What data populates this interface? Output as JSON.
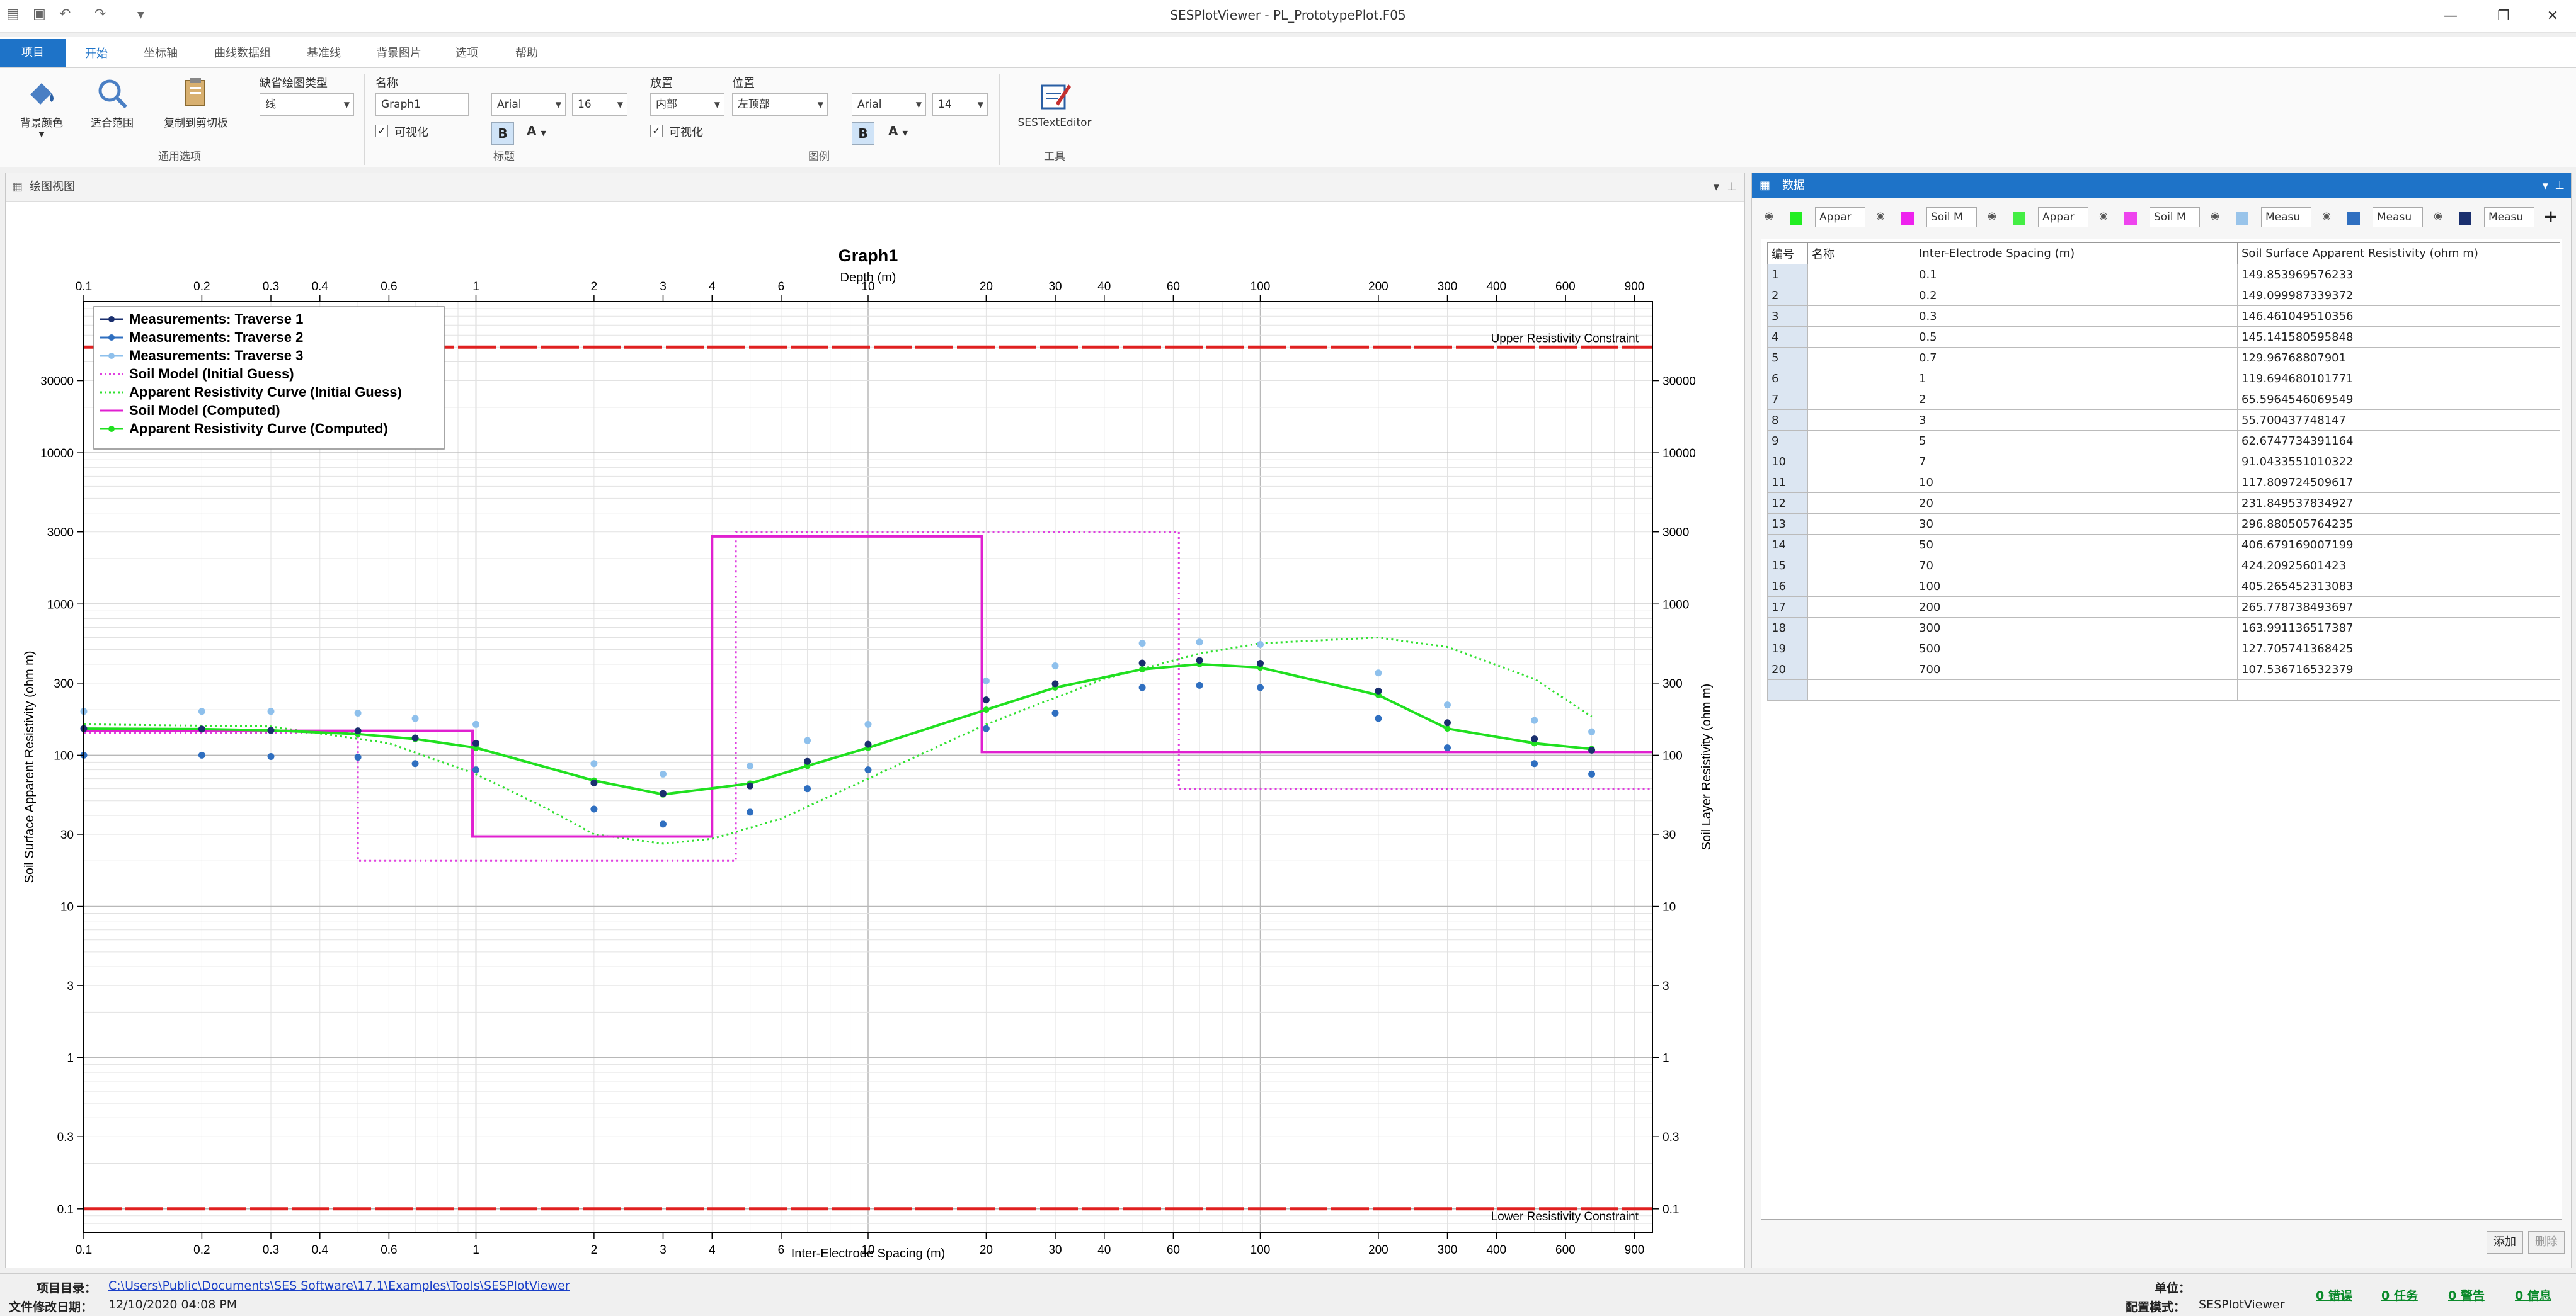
{
  "window": {
    "title": "SESPlotViewer - PL_PrototypePlot.F05",
    "minimize": "—",
    "restore": "❐",
    "close": "✕"
  },
  "menu": {
    "file": "项目",
    "tabs": [
      "开始",
      "坐标轴",
      "曲线数据组",
      "基准线",
      "背景图片",
      "选项",
      "帮助"
    ]
  },
  "ribbon": {
    "background_color": "背景颜色",
    "fit_range": "适合范围",
    "copy_clipboard": "复制到剪切板",
    "group_general": "通用选项",
    "default_plot_type_label": "缺省绘图类型",
    "default_plot_type": "线",
    "title_name_label": "名称",
    "title_name": "Graph1",
    "title_visible": "可视化",
    "title_font": "Arial",
    "title_size": "16",
    "group_title": "标题",
    "legend_place_label": "放置",
    "legend_place": "内部",
    "legend_pos_label": "位置",
    "legend_pos": "左顶部",
    "legend_visible": "可视化",
    "legend_font": "Arial",
    "legend_size": "14",
    "group_legend": "图例",
    "text_editor": "SESTextEditor",
    "group_tools": "工具",
    "bold_glyph": "B",
    "color_glyph": "A"
  },
  "plot_panel": {
    "title": "绘图视图"
  },
  "chart_data": {
    "type": "line",
    "title": "Graph1",
    "top_axis_label": "Depth (m)",
    "xlabel": "Inter-Electrode Spacing (m)",
    "ylabel_left": "Soil Surface Apparent Resistivity (ohm m)",
    "ylabel_right": "Soil Layer Resistivity (ohm m)",
    "x_scale": "log",
    "y_scale": "log",
    "xlim": [
      0.1,
      1000
    ],
    "ylim": [
      0.07,
      100000
    ],
    "x_ticks": [
      0.1,
      0.2,
      0.3,
      0.4,
      0.6,
      1,
      2,
      3,
      4,
      6,
      10,
      20,
      30,
      40,
      60,
      100,
      200,
      300,
      400,
      600,
      900
    ],
    "x_tick_labels": [
      "0.1",
      "0.2",
      "0.3",
      "0.4",
      "0.6",
      "1",
      "2",
      "3",
      "4",
      "6",
      "10",
      "20",
      "30",
      "40",
      "60",
      "100",
      "200",
      "300",
      "400",
      "600",
      "900"
    ],
    "y_ticks": [
      0.1,
      0.3,
      1,
      3,
      10,
      30,
      100,
      300,
      1000,
      3000,
      10000,
      30000
    ],
    "y_tick_labels": [
      "0.1",
      "0.3",
      "1",
      "3",
      "10",
      "30",
      "100",
      "300",
      "1000",
      "3000",
      "10000",
      "30000"
    ],
    "grid": true,
    "legend_position": "top-left",
    "reference_lines": [
      {
        "label": "Upper Resistivity Constraint",
        "y": 50000,
        "color": "#e02020"
      },
      {
        "label": "Lower Resistivity Constraint",
        "y": 0.1,
        "color": "#e02020"
      }
    ],
    "series": [
      {
        "name": "Measurements: Traverse 1",
        "kind": "points",
        "color": "#1a2f6e",
        "x": [
          0.1,
          0.2,
          0.3,
          0.5,
          0.7,
          1,
          2,
          3,
          5,
          7,
          10,
          20,
          30,
          50,
          70,
          100,
          200,
          300,
          500,
          700
        ],
        "y": [
          150,
          149,
          146,
          145,
          130,
          120,
          65.6,
          55.7,
          62.7,
          91,
          118,
          232,
          297,
          407,
          424,
          405,
          266,
          164,
          128,
          108
        ]
      },
      {
        "name": "Measurements: Traverse 2",
        "kind": "points",
        "color": "#2f6fc0",
        "x": [
          0.1,
          0.2,
          0.3,
          0.5,
          0.7,
          1,
          2,
          3,
          5,
          7,
          10,
          20,
          30,
          50,
          70,
          100,
          200,
          300,
          500,
          700
        ],
        "y": [
          100,
          100,
          98,
          97,
          88,
          80,
          44,
          35,
          42,
          60,
          80,
          150,
          190,
          280,
          290,
          280,
          175,
          112,
          88,
          75
        ]
      },
      {
        "name": "Measurements: Traverse 3",
        "kind": "points",
        "color": "#8ec0ec",
        "x": [
          0.1,
          0.2,
          0.3,
          0.5,
          0.7,
          1,
          2,
          3,
          5,
          7,
          10,
          20,
          30,
          50,
          70,
          100,
          200,
          300,
          500,
          700
        ],
        "y": [
          195,
          195,
          195,
          190,
          175,
          160,
          88,
          75,
          85,
          125,
          160,
          310,
          390,
          550,
          560,
          540,
          350,
          215,
          170,
          143
        ]
      },
      {
        "name": "Soil Model (Initial Guess)",
        "kind": "step-dotted",
        "color": "#e040e0",
        "x": [
          0.1,
          0.5,
          0.5,
          4.6,
          4.6,
          62,
          62,
          1000
        ],
        "y": [
          140,
          140,
          20,
          20,
          3000,
          3000,
          60,
          60
        ]
      },
      {
        "name": "Apparent Resistivity Curve (Initial Guess)",
        "kind": "line-dotted",
        "color": "#30e030",
        "x": [
          0.1,
          0.3,
          0.6,
          1,
          1.5,
          2,
          3,
          4,
          6,
          10,
          20,
          40,
          70,
          100,
          200,
          300,
          500,
          700
        ],
        "y": [
          160,
          155,
          120,
          75,
          45,
          30,
          26,
          28,
          38,
          70,
          160,
          320,
          470,
          550,
          600,
          520,
          320,
          180
        ]
      },
      {
        "name": "Soil Model (Computed)",
        "kind": "step",
        "color": "#e020d0",
        "x": [
          0.1,
          0.98,
          0.98,
          4.0,
          4.0,
          19.5,
          19.5,
          1000
        ],
        "y": [
          145,
          145,
          29,
          29,
          2800,
          2800,
          105,
          105
        ]
      },
      {
        "name": "Apparent Resistivity Curve (Computed)",
        "kind": "line-markers",
        "color": "#20e020",
        "x": [
          0.1,
          0.2,
          0.3,
          0.5,
          0.7,
          1,
          2,
          3,
          5,
          7,
          10,
          20,
          30,
          50,
          70,
          100,
          200,
          300,
          500,
          700
        ],
        "y": [
          150,
          149,
          146,
          138,
          128,
          112,
          68,
          55,
          65,
          85,
          112,
          200,
          280,
          370,
          400,
          380,
          250,
          150,
          120,
          110
        ]
      }
    ]
  },
  "data_panel": {
    "title": "数据",
    "series_tabs": [
      {
        "name": "Appar",
        "color": "#22ee22"
      },
      {
        "name": "Soil M",
        "color": "#ee22ee"
      },
      {
        "name": "Appar",
        "color": "#44ee44"
      },
      {
        "name": "Soil M",
        "color": "#ee44ee"
      },
      {
        "name": "Measu",
        "color": "#99c4ea"
      },
      {
        "name": "Measu",
        "color": "#2f6fc0"
      },
      {
        "name": "Measu",
        "color": "#1a2f6e"
      }
    ],
    "add_tab": "+",
    "headers": [
      "编号",
      "名称",
      "Inter-Electrode Spacing (m)",
      "Soil Surface Apparent Resistivity (ohm m)"
    ],
    "rows": [
      [
        "1",
        "",
        "0.1",
        "149.853969576233"
      ],
      [
        "2",
        "",
        "0.2",
        "149.099987339372"
      ],
      [
        "3",
        "",
        "0.3",
        "146.461049510356"
      ],
      [
        "4",
        "",
        "0.5",
        "145.141580595848"
      ],
      [
        "5",
        "",
        "0.7",
        "129.96768807901"
      ],
      [
        "6",
        "",
        "1",
        "119.694680101771"
      ],
      [
        "7",
        "",
        "2",
        "65.5964546069549"
      ],
      [
        "8",
        "",
        "3",
        "55.700437748147"
      ],
      [
        "9",
        "",
        "5",
        "62.6747734391164"
      ],
      [
        "10",
        "",
        "7",
        "91.0433551010322"
      ],
      [
        "11",
        "",
        "10",
        "117.809724509617"
      ],
      [
        "12",
        "",
        "20",
        "231.849537834927"
      ],
      [
        "13",
        "",
        "30",
        "296.880505764235"
      ],
      [
        "14",
        "",
        "50",
        "406.679169007199"
      ],
      [
        "15",
        "",
        "70",
        "424.20925601423"
      ],
      [
        "16",
        "",
        "100",
        "405.265452313083"
      ],
      [
        "17",
        "",
        "200",
        "265.778738493697"
      ],
      [
        "18",
        "",
        "300",
        "163.991136517387"
      ],
      [
        "19",
        "",
        "500",
        "127.705741368425"
      ],
      [
        "20",
        "",
        "700",
        "107.536716532379"
      ]
    ],
    "add_button": "添加",
    "delete_button": "删除"
  },
  "status": {
    "project_dir_label": "项目目录：",
    "project_dir": "C:\\Users\\Public\\Documents\\SES Software\\17.1\\Examples\\Tools\\SESPlotViewer",
    "modified_label": "文件修改日期：",
    "modified": "12/10/2020 04:08 PM",
    "units_label": "单位：",
    "config_label": "配置模式：",
    "config": "SESPlotViewer",
    "errors": "0 错误",
    "tasks": "0 任务",
    "warnings": "0 警告",
    "info": "0 信息"
  }
}
